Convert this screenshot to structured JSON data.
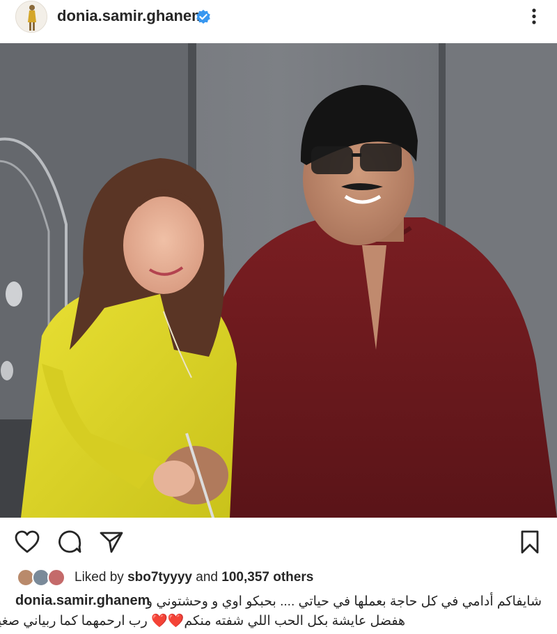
{
  "header": {
    "username": "donia.samir.ghanem",
    "avatar_icon": "profile-avatar",
    "verified_icon": "verified-badge-icon",
    "more_icon": "more-vertical-icon"
  },
  "post": {
    "image_alt": "photo"
  },
  "actions": {
    "like_icon": "heart-icon",
    "comment_icon": "comment-icon",
    "share_icon": "send-icon",
    "save_icon": "bookmark-icon"
  },
  "likes": {
    "prefix": "Liked by",
    "liker": "sbo7tyyyy",
    "conjunction": "and",
    "others_count": "100,357 others"
  },
  "caption": {
    "username": "donia.samir.ghanem",
    "line1": "شايفاكم أدامي في كل حاجة بعملها في حياتي .... بحبكو اوي و وحشتوني و",
    "line2": "هفضل عايشة بكل الحب اللي شفته منكم❤️❤️ رب ارحمهما كما ربياني صغيرا"
  },
  "colors": {
    "verified": "#3897f0",
    "text": "#262626",
    "heart": "#e0245e"
  }
}
